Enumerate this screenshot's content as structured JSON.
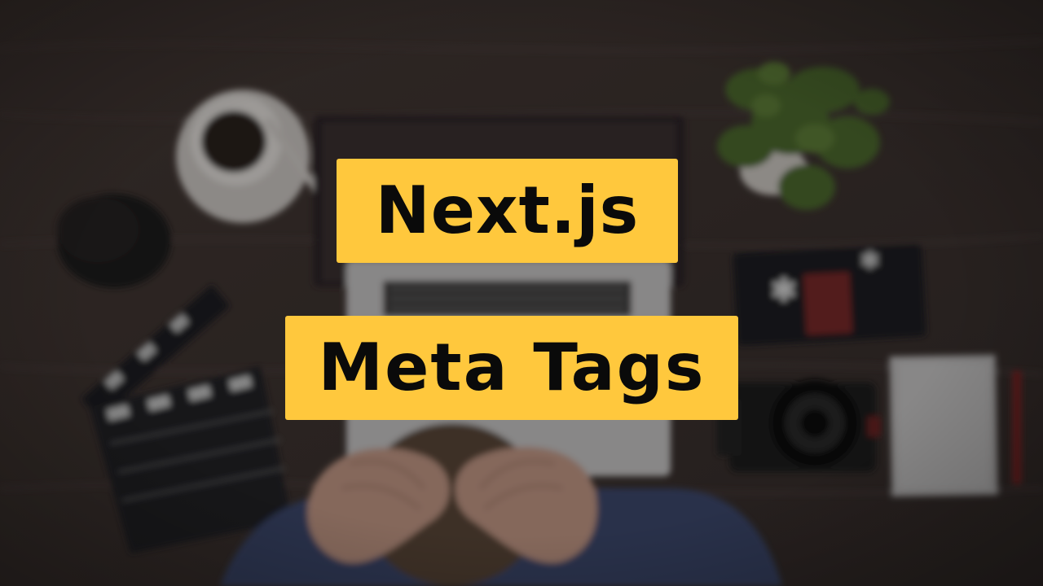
{
  "thumbnail": {
    "title_line1": "Next.js",
    "title_line2": "Meta Tags",
    "accent_color": "#ffc83d",
    "text_color": "#0a0a0a"
  },
  "background": {
    "scene": "blurred desk photo",
    "objects": [
      "coffee-cup",
      "laptop",
      "potted-plant",
      "camera-lens",
      "clapperboard",
      "pencil-case",
      "camera",
      "notepad",
      "pen",
      "person-with-hands-on-head"
    ]
  }
}
